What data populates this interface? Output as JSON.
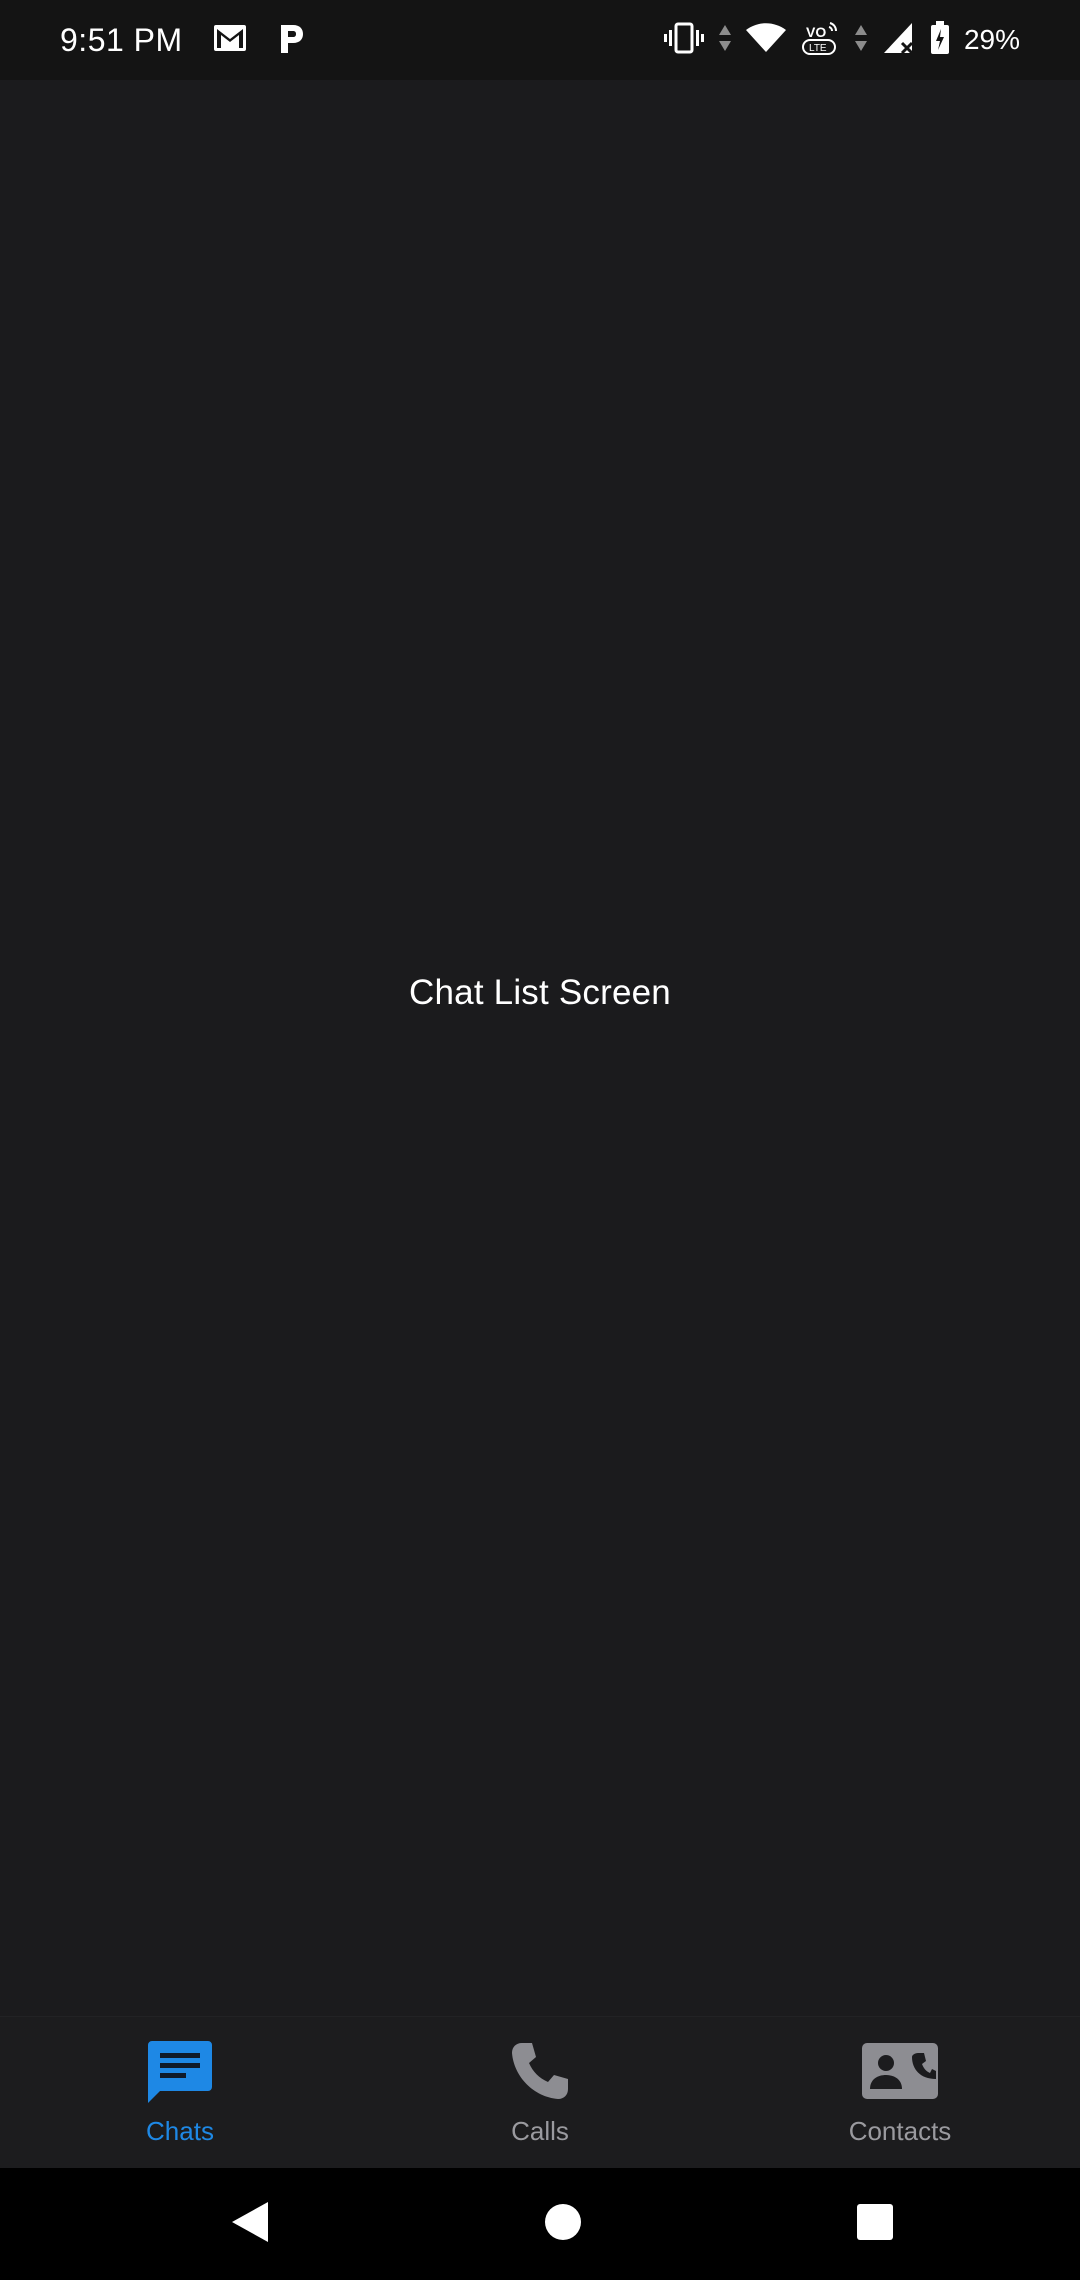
{
  "status_bar": {
    "time": "9:51 PM",
    "battery": "29%",
    "icons": [
      "gmail-icon",
      "pocket-casts-icon",
      "vibrate-icon",
      "wifi-icon",
      "volte-icon",
      "cell-signal-icon",
      "battery-icon"
    ]
  },
  "main": {
    "title": "Chat List Screen"
  },
  "bottom_nav": {
    "items": [
      {
        "label": "Chats",
        "icon": "chat-icon",
        "active": true
      },
      {
        "label": "Calls",
        "icon": "phone-icon",
        "active": false
      },
      {
        "label": "Contacts",
        "icon": "contacts-icon",
        "active": false
      }
    ],
    "active_color": "#1e88e5",
    "inactive_color": "#9a9a9f"
  },
  "system_nav": {
    "buttons": [
      "back-icon",
      "home-icon",
      "recents-icon"
    ]
  }
}
